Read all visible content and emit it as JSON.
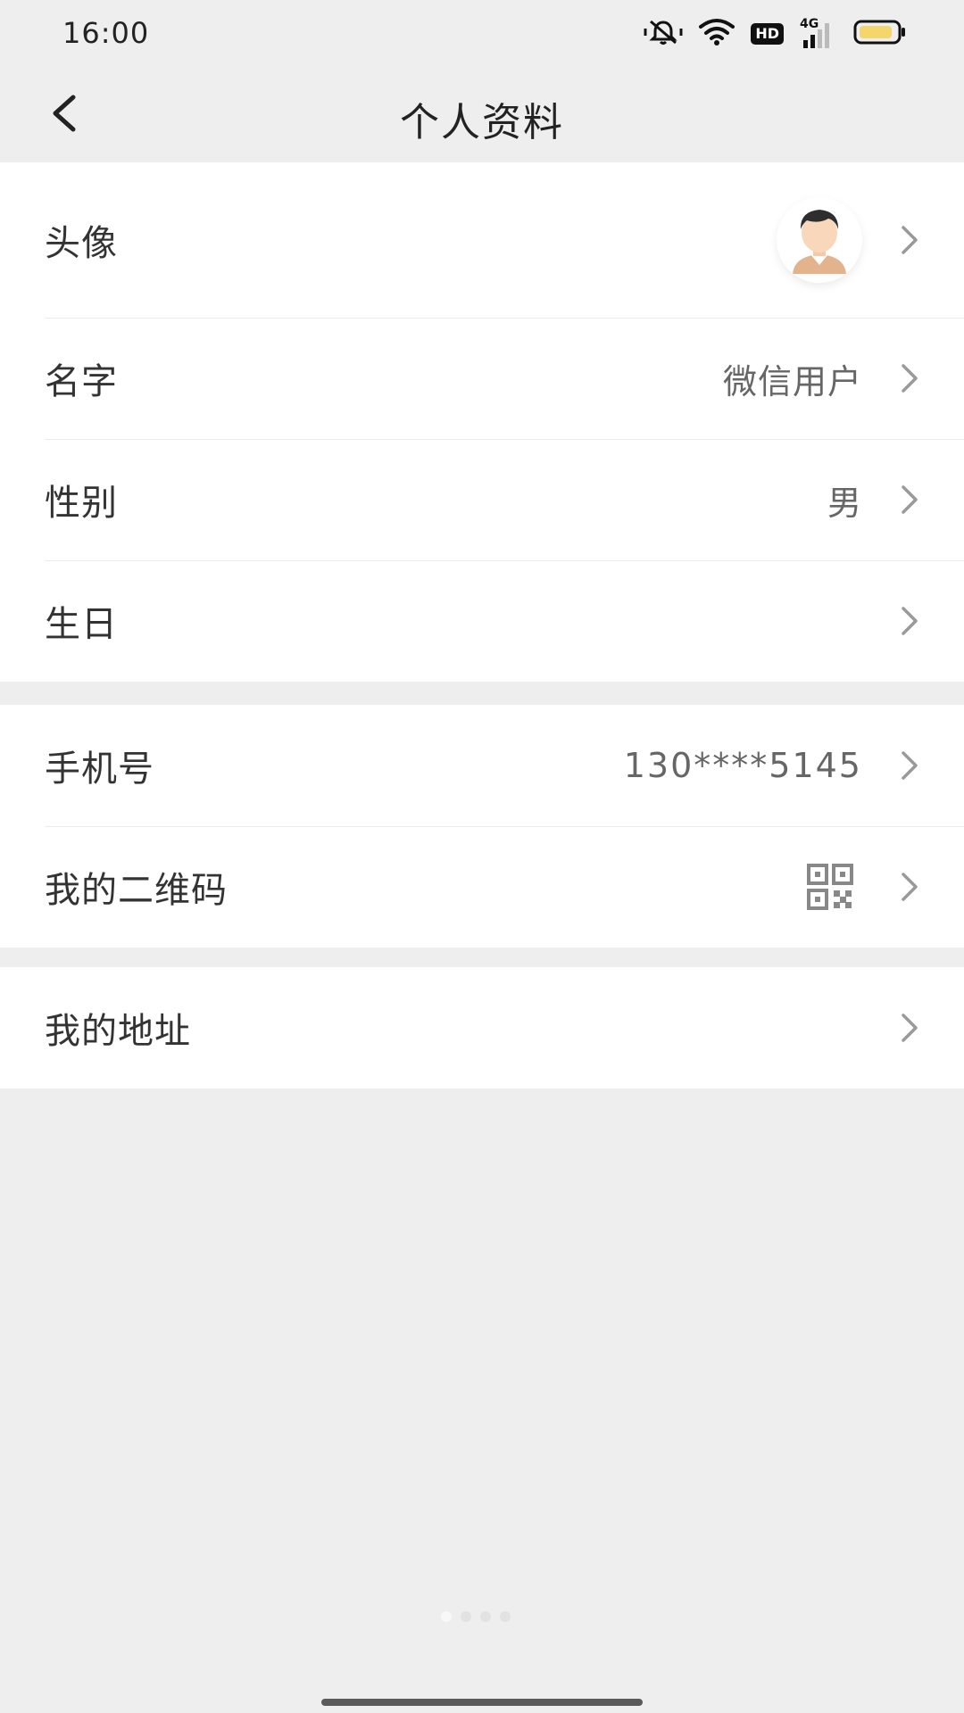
{
  "status_bar": {
    "time": "16:00",
    "hd": "HD",
    "network": "4G",
    "icons": [
      "mute-alarm-icon",
      "wifi-icon",
      "hd-icon",
      "signal-icon",
      "battery-icon"
    ],
    "battery_color": "#f5d66b"
  },
  "header": {
    "title": "个人资料",
    "back_icon": "back-arrow-icon"
  },
  "profile": {
    "avatar_label": "头像",
    "name_label": "名字",
    "name_value": "微信用户",
    "gender_label": "性别",
    "gender_value": "男",
    "birthday_label": "生日"
  },
  "contact": {
    "phone_label": "手机号",
    "phone_value": "130****5145",
    "qr_label": "我的二维码"
  },
  "address": {
    "label": "我的地址"
  },
  "colors": {
    "background": "#eeeeee",
    "card": "#ffffff",
    "text": "#333333",
    "secondary": "#666666",
    "chevron": "#999999"
  }
}
